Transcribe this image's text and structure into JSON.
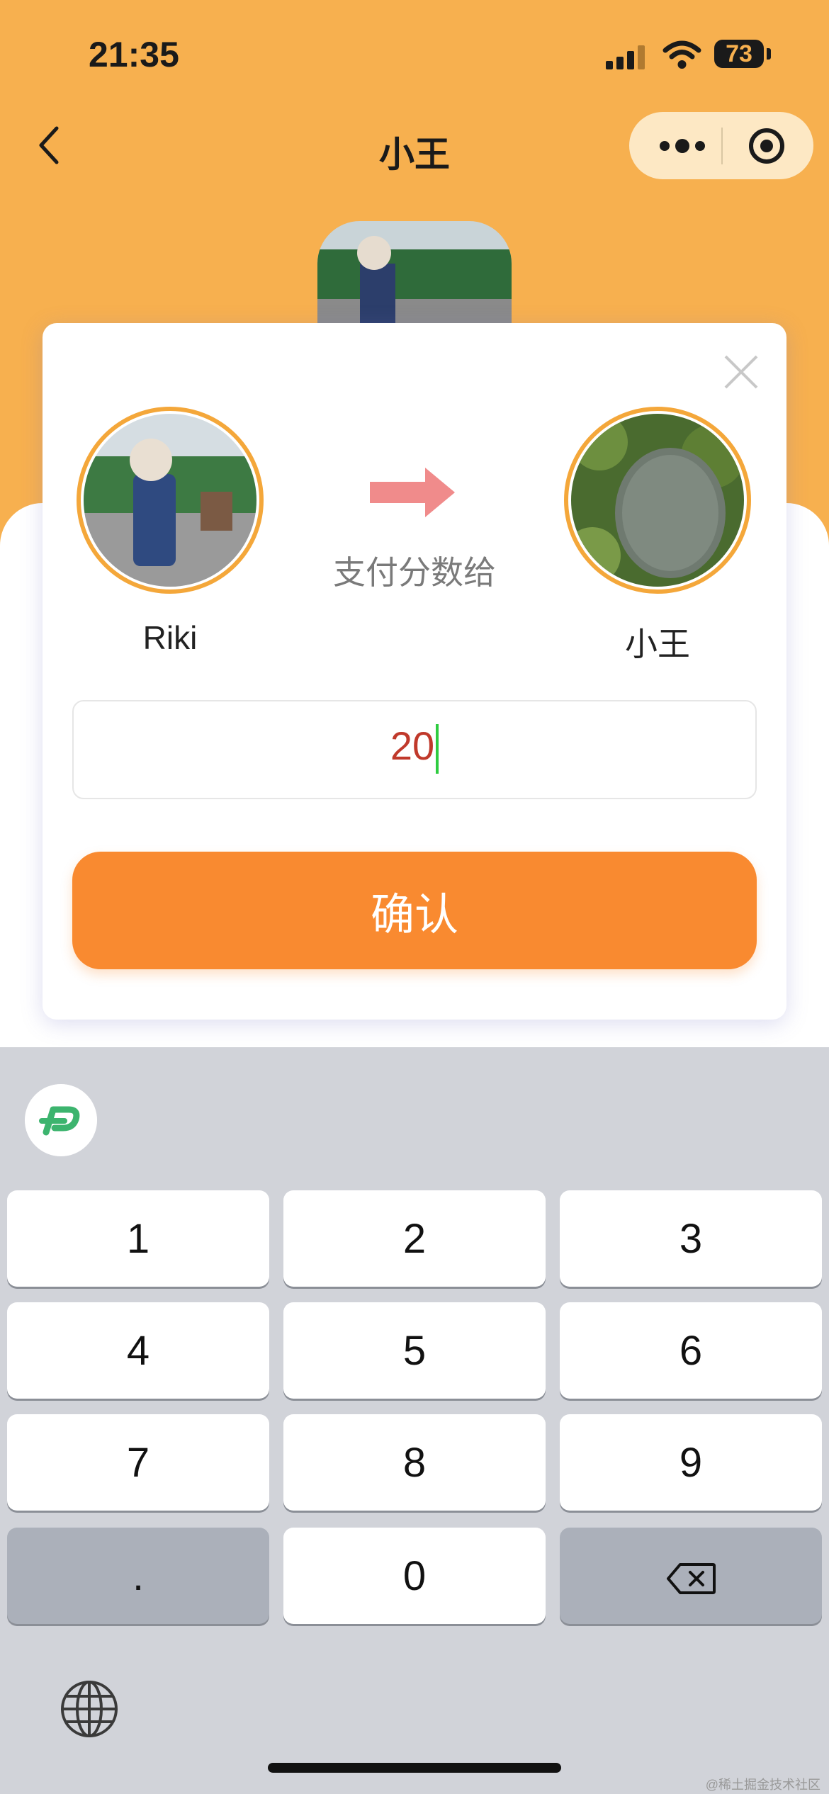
{
  "status_bar": {
    "time": "21:35",
    "battery": "73"
  },
  "nav": {
    "title": "小王"
  },
  "dialog": {
    "from_name": "Riki",
    "to_name": "小王",
    "pay_label": "支付分数给",
    "amount_value": "20",
    "confirm_label": "确认"
  },
  "keyboard": {
    "keys": [
      "1",
      "2",
      "3",
      "4",
      "5",
      "6",
      "7",
      "8",
      "9",
      ".",
      "0"
    ]
  },
  "watermark": "@稀土掘金技术社区"
}
